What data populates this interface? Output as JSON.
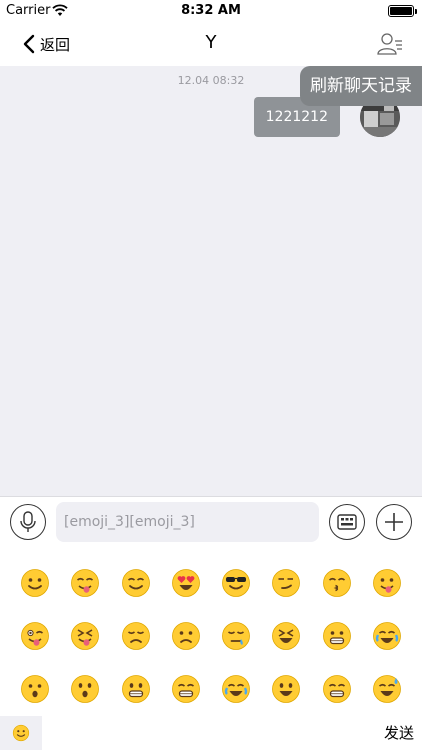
{
  "status_bar": {
    "carrier": "Carrier",
    "time": "8:32 AM",
    "battery_level": 1.0
  },
  "nav": {
    "back_label": "返回",
    "title": "Y",
    "right_icon": "user-list-icon"
  },
  "chat": {
    "timestamp": "12.04 08:32",
    "messages": [
      {
        "text": "1221212",
        "from": "self"
      }
    ],
    "refresh_label": "刷新聊天记录"
  },
  "input": {
    "value": "[emoji_3][emoji_3]",
    "voice_icon": "microphone-icon",
    "keyboard_icon": "keyboard-icon",
    "more_icon": "plus-icon"
  },
  "emoji_panel": {
    "emojis": [
      "grinning",
      "savoring",
      "relieved",
      "heart-eyes",
      "sunglasses",
      "smirk",
      "kissing-closed-eyes",
      "tongue-out",
      "winking-tongue",
      "squinting-tongue",
      "disappointed",
      "worried",
      "sleepy",
      "tired",
      "grimacing",
      "crying",
      "open-mouth",
      "hushed",
      "grinning-teeth",
      "beaming",
      "tears-of-joy",
      "smiley",
      "grin",
      "sweat-smile"
    ]
  },
  "bottom_bar": {
    "emoji_tab_icon": "smiley-icon",
    "send_label": "发送"
  },
  "colors": {
    "chat_bg": "#efeff4",
    "bubble": "#8f9397",
    "tooltip": "#808487",
    "emoji_yellow": "#ffcc33"
  }
}
